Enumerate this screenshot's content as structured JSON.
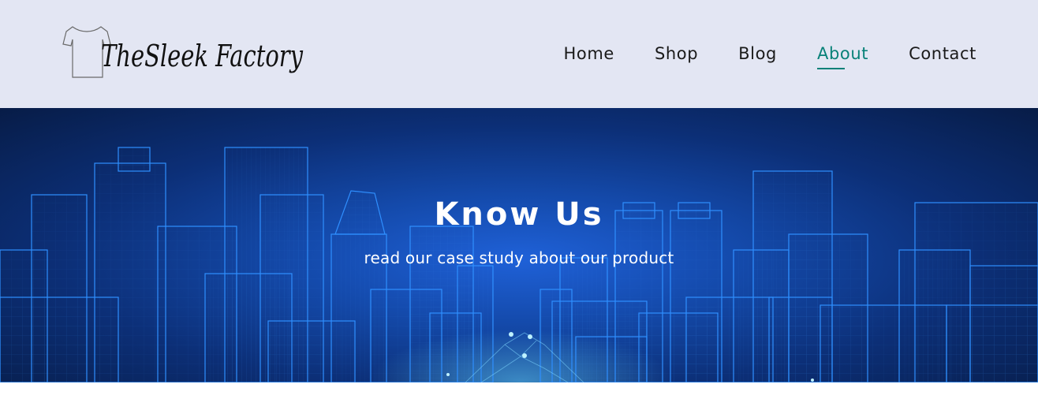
{
  "header": {
    "logo_text": "TheSleek Factory",
    "nav": [
      {
        "label": "Home",
        "active": false
      },
      {
        "label": "Shop",
        "active": false
      },
      {
        "label": "Blog",
        "active": false
      },
      {
        "label": "About",
        "active": true
      },
      {
        "label": "Contact",
        "active": false
      }
    ]
  },
  "hero": {
    "title": "Know Us",
    "subtitle": "read our case study about our product",
    "background_icon": "wireframe-city-skyline"
  },
  "colors": {
    "header_bg": "#e3e6f3",
    "accent": "#088178",
    "hero_bg": "#0c2f77",
    "hero_line": "#2f8fff"
  }
}
